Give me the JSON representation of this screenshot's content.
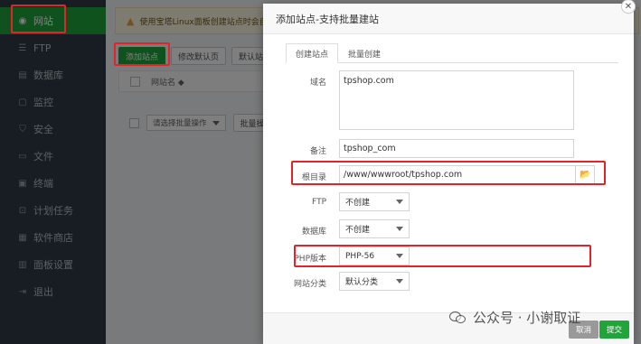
{
  "sidebar": {
    "items": [
      {
        "label": "网站",
        "icon": "globe-icon",
        "active": true
      },
      {
        "label": "FTP",
        "icon": "ftp-icon"
      },
      {
        "label": "数据库",
        "icon": "database-icon"
      },
      {
        "label": "监控",
        "icon": "monitor-icon"
      },
      {
        "label": "安全",
        "icon": "shield-icon"
      },
      {
        "label": "文件",
        "icon": "folder-icon"
      },
      {
        "label": "终端",
        "icon": "terminal-icon"
      },
      {
        "label": "计划任务",
        "icon": "clock-icon"
      },
      {
        "label": "软件商店",
        "icon": "store-icon"
      },
      {
        "label": "面板设置",
        "icon": "settings-icon"
      },
      {
        "label": "退出",
        "icon": "logout-icon"
      }
    ]
  },
  "main": {
    "notice": "使用宝塔Linux面板创建站点时会自动",
    "toolbar": {
      "add_site": "添加站点",
      "modify_default_page": "修改默认页",
      "default_site": "默认站点"
    },
    "table": {
      "col_site_name": "网站名 ◆"
    },
    "batch": {
      "select_placeholder": "请选择批量操作",
      "batch_button": "批量操作"
    }
  },
  "modal": {
    "title": "添加站点-支持批量建站",
    "tabs": [
      "创建站点",
      "批量创建"
    ],
    "domain_label": "域名",
    "domain_value": "tpshop.com",
    "remark_label": "备注",
    "remark_value": "tpshop_com",
    "root_label": "根目录",
    "root_value": "/www/wwwroot/tpshop.com",
    "ftp_label": "FTP",
    "ftp_value": "不创建",
    "db_label": "数据库",
    "db_value": "不创建",
    "php_label": "PHP版本",
    "php_value": "PHP-56",
    "category_label": "网站分类",
    "category_value": "默认分类",
    "cancel": "取消",
    "submit": "提交"
  },
  "watermark": "公众号 · 小谢取证",
  "colors": {
    "accent": "#20a53a",
    "sidebar": "#2f3a44",
    "highlight": "#e2232a"
  }
}
